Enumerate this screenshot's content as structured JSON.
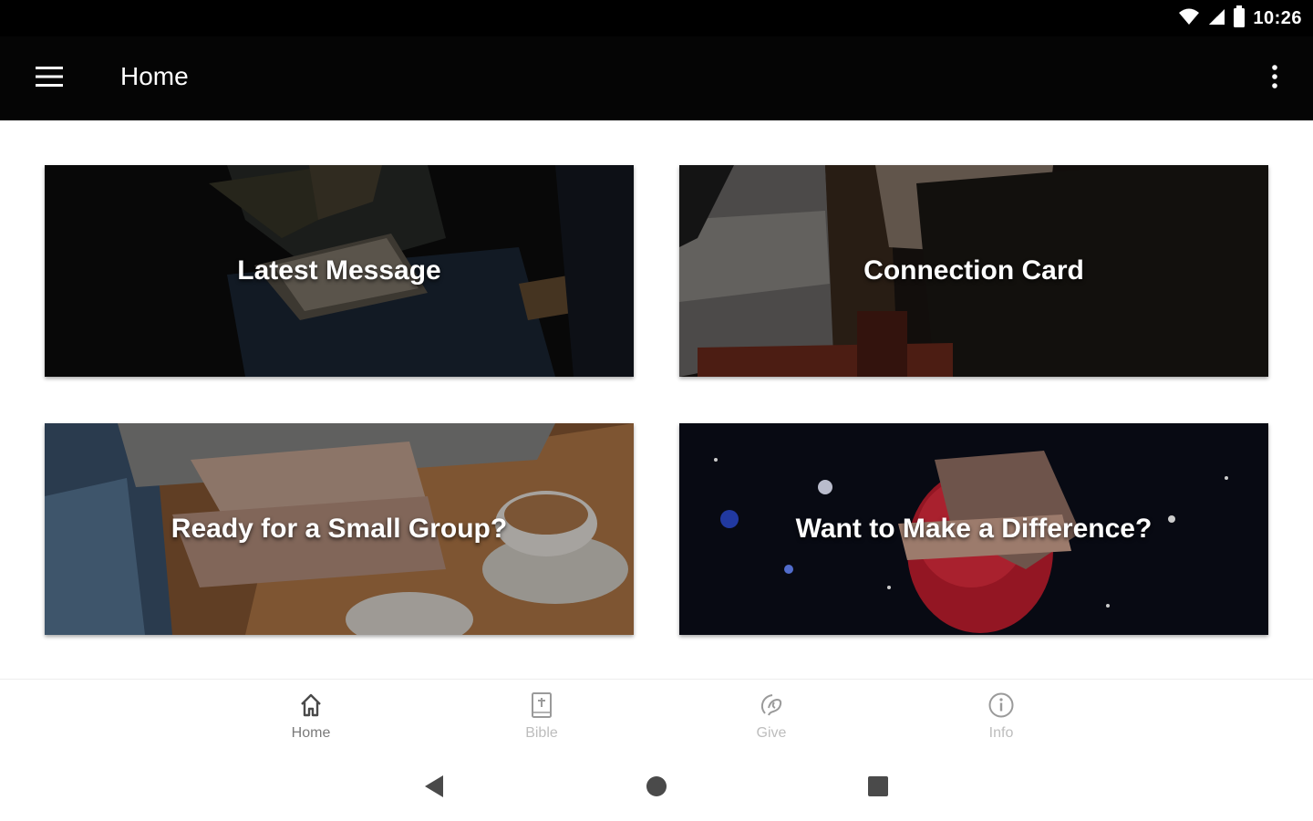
{
  "status_bar": {
    "time": "10:26",
    "icons": [
      "wifi-icon",
      "cell-signal-icon",
      "battery-icon"
    ]
  },
  "app_bar": {
    "title": "Home",
    "menu_icon": "hamburger-menu-icon",
    "overflow_icon": "more-vert-icon"
  },
  "cards": [
    {
      "label": "Latest Message"
    },
    {
      "label": "Connection Card"
    },
    {
      "label": "Ready for a Small Group?"
    },
    {
      "label": "Want to Make a Difference?"
    }
  ],
  "bottom_nav": [
    {
      "label": "Home",
      "icon": "home-icon",
      "active": true
    },
    {
      "label": "Bible",
      "icon": "bible-icon",
      "active": false
    },
    {
      "label": "Give",
      "icon": "give-icon",
      "active": false
    },
    {
      "label": "Info",
      "icon": "info-icon",
      "active": false
    }
  ],
  "system_nav": [
    "back-icon",
    "home-circle-icon",
    "recents-icon"
  ],
  "colors": {
    "app_bar": "#050505",
    "status_bar": "#000000",
    "nav_active": "#7a7a7a",
    "nav_inactive": "#bdbdbd"
  }
}
